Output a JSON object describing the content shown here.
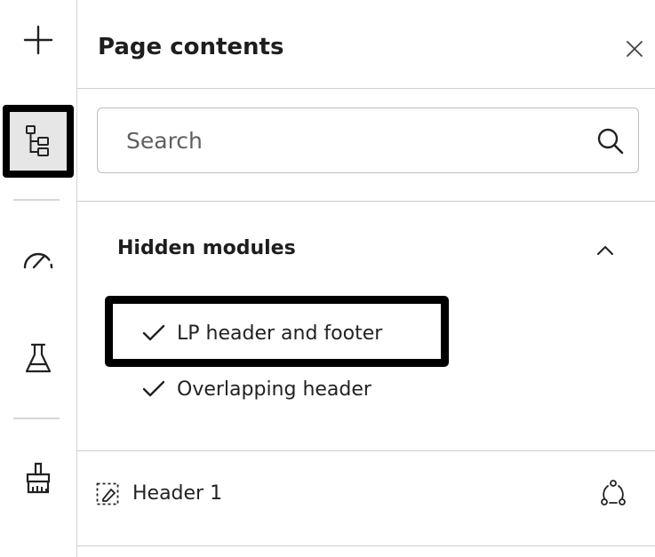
{
  "rail": {
    "items": [
      {
        "icon": "plus-icon"
      },
      {
        "icon": "page-tree-icon",
        "active": true
      },
      {
        "icon": "gauge-icon"
      },
      {
        "icon": "flask-icon"
      },
      {
        "icon": "brush-icon"
      }
    ]
  },
  "panel": {
    "title": "Page contents",
    "close_icon": "close-icon"
  },
  "search": {
    "value": "",
    "placeholder": "Search",
    "icon": "search-icon"
  },
  "hidden_modules": {
    "title": "Hidden modules",
    "expanded": true,
    "items": [
      {
        "label": "LP header and footer",
        "checked": true,
        "highlighted": true
      },
      {
        "label": "Overlapping header",
        "checked": true,
        "highlighted": false
      }
    ]
  },
  "modules": [
    {
      "label": "Header 1",
      "icon": "module-select-icon",
      "action_icon": "global-module-icon"
    }
  ],
  "colors": {
    "highlight_border": "#000000",
    "active_background": "#e6e6e6",
    "divider": "#cfcfcf",
    "text": "#1f1f1f"
  }
}
